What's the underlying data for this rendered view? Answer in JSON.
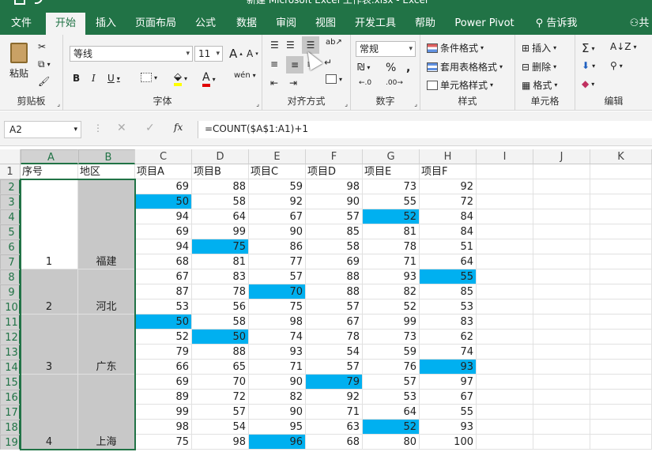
{
  "window": {
    "title": "新建 Microsoft Excel 工作表.xlsx  -  Excel"
  },
  "tabs": [
    "文件",
    "开始",
    "插入",
    "页面布局",
    "公式",
    "数据",
    "审阅",
    "视图",
    "开发工具",
    "帮助",
    "Power Pivot"
  ],
  "active_tab": "开始",
  "tell_me": "告诉我",
  "share": "共",
  "ribbon": {
    "clipboard": {
      "label": "剪贴板",
      "paste": "粘贴"
    },
    "font": {
      "label": "字体",
      "name": "等线",
      "size": "11",
      "bold": "B",
      "italic": "I",
      "underline": "U",
      "grow": "A",
      "shrink": "A",
      "color_a": "A",
      "phonetic": "wén"
    },
    "alignment": {
      "label": "对齐方式"
    },
    "number": {
      "label": "数字",
      "format": "常规",
      "percent": "%",
      "comma": ","
    },
    "styles": {
      "label": "样式",
      "conditional": "条件格式",
      "table": "套用表格格式",
      "cell": "单元格样式"
    },
    "cells": {
      "label": "单元格",
      "insert": "插入",
      "delete": "删除",
      "format": "格式"
    },
    "editing": {
      "label": "编辑"
    }
  },
  "formula_bar": {
    "name_box": "A2",
    "formula": "=COUNT($A$1:A1)+1"
  },
  "columns": [
    "A",
    "B",
    "C",
    "D",
    "E",
    "F",
    "G",
    "H",
    "I",
    "J",
    "K"
  ],
  "headers": [
    "序号",
    "地区",
    "项目A",
    "项目B",
    "项目C",
    "项目D",
    "项目E",
    "项目F"
  ],
  "rows": [
    [
      69,
      88,
      59,
      98,
      73,
      92
    ],
    [
      50,
      58,
      92,
      90,
      55,
      72
    ],
    [
      94,
      64,
      67,
      57,
      52,
      84
    ],
    [
      69,
      99,
      90,
      85,
      81,
      84
    ],
    [
      94,
      75,
      86,
      58,
      78,
      51
    ],
    [
      68,
      81,
      77,
      69,
      71,
      64
    ],
    [
      67,
      83,
      57,
      88,
      93,
      55
    ],
    [
      87,
      78,
      70,
      88,
      82,
      85
    ],
    [
      53,
      56,
      75,
      57,
      52,
      53
    ],
    [
      50,
      58,
      98,
      67,
      99,
      83
    ],
    [
      52,
      50,
      74,
      78,
      73,
      62
    ],
    [
      79,
      88,
      93,
      54,
      59,
      74
    ],
    [
      66,
      65,
      71,
      57,
      76,
      93
    ],
    [
      69,
      70,
      90,
      79,
      57,
      97
    ],
    [
      89,
      72,
      82,
      92,
      53,
      67
    ],
    [
      99,
      57,
      90,
      71,
      64,
      55
    ],
    [
      98,
      54,
      95,
      63,
      52,
      93
    ],
    [
      75,
      98,
      96,
      68,
      80,
      100
    ]
  ],
  "groups": [
    {
      "no": "1",
      "region": "福建"
    },
    {
      "no": "2",
      "region": "河北"
    },
    {
      "no": "3",
      "region": "广东"
    },
    {
      "no": "4",
      "region": "上海"
    }
  ],
  "highlight_color": "#00b0f0",
  "accent_color": "#217346"
}
